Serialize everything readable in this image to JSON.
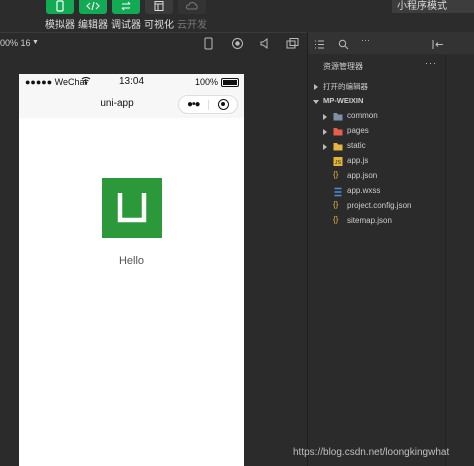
{
  "toolbar": {
    "simulator_label": "模拟器",
    "editor_label": "编辑器",
    "debugger_label": "调试器",
    "visualize_label": "可视化",
    "cloud_label": "云开发",
    "mode_label": "小程序模式",
    "accent_color": "#12ab54"
  },
  "subbar": {
    "zoom_label": "00% 16"
  },
  "phone": {
    "status": {
      "carrier": "●●●●● WeChat",
      "time": "13:04",
      "battery": "100%"
    },
    "nav_title": "uni-app",
    "body_text": "Hello",
    "logo_color": "#2b9939"
  },
  "explorer": {
    "title": "资源管理器",
    "open_editors": "打开的编辑器",
    "project": "MP-WEIXIN",
    "items": [
      {
        "label": "common",
        "type": "folder"
      },
      {
        "label": "pages",
        "type": "folder"
      },
      {
        "label": "static",
        "type": "folder"
      },
      {
        "label": "app.js",
        "type": "js"
      },
      {
        "label": "app.json",
        "type": "json"
      },
      {
        "label": "app.wxss",
        "type": "wxss"
      },
      {
        "label": "project.config.json",
        "type": "json"
      },
      {
        "label": "sitemap.json",
        "type": "json"
      }
    ]
  },
  "watermark": "https://blog.csdn.net/loongkingwhat"
}
